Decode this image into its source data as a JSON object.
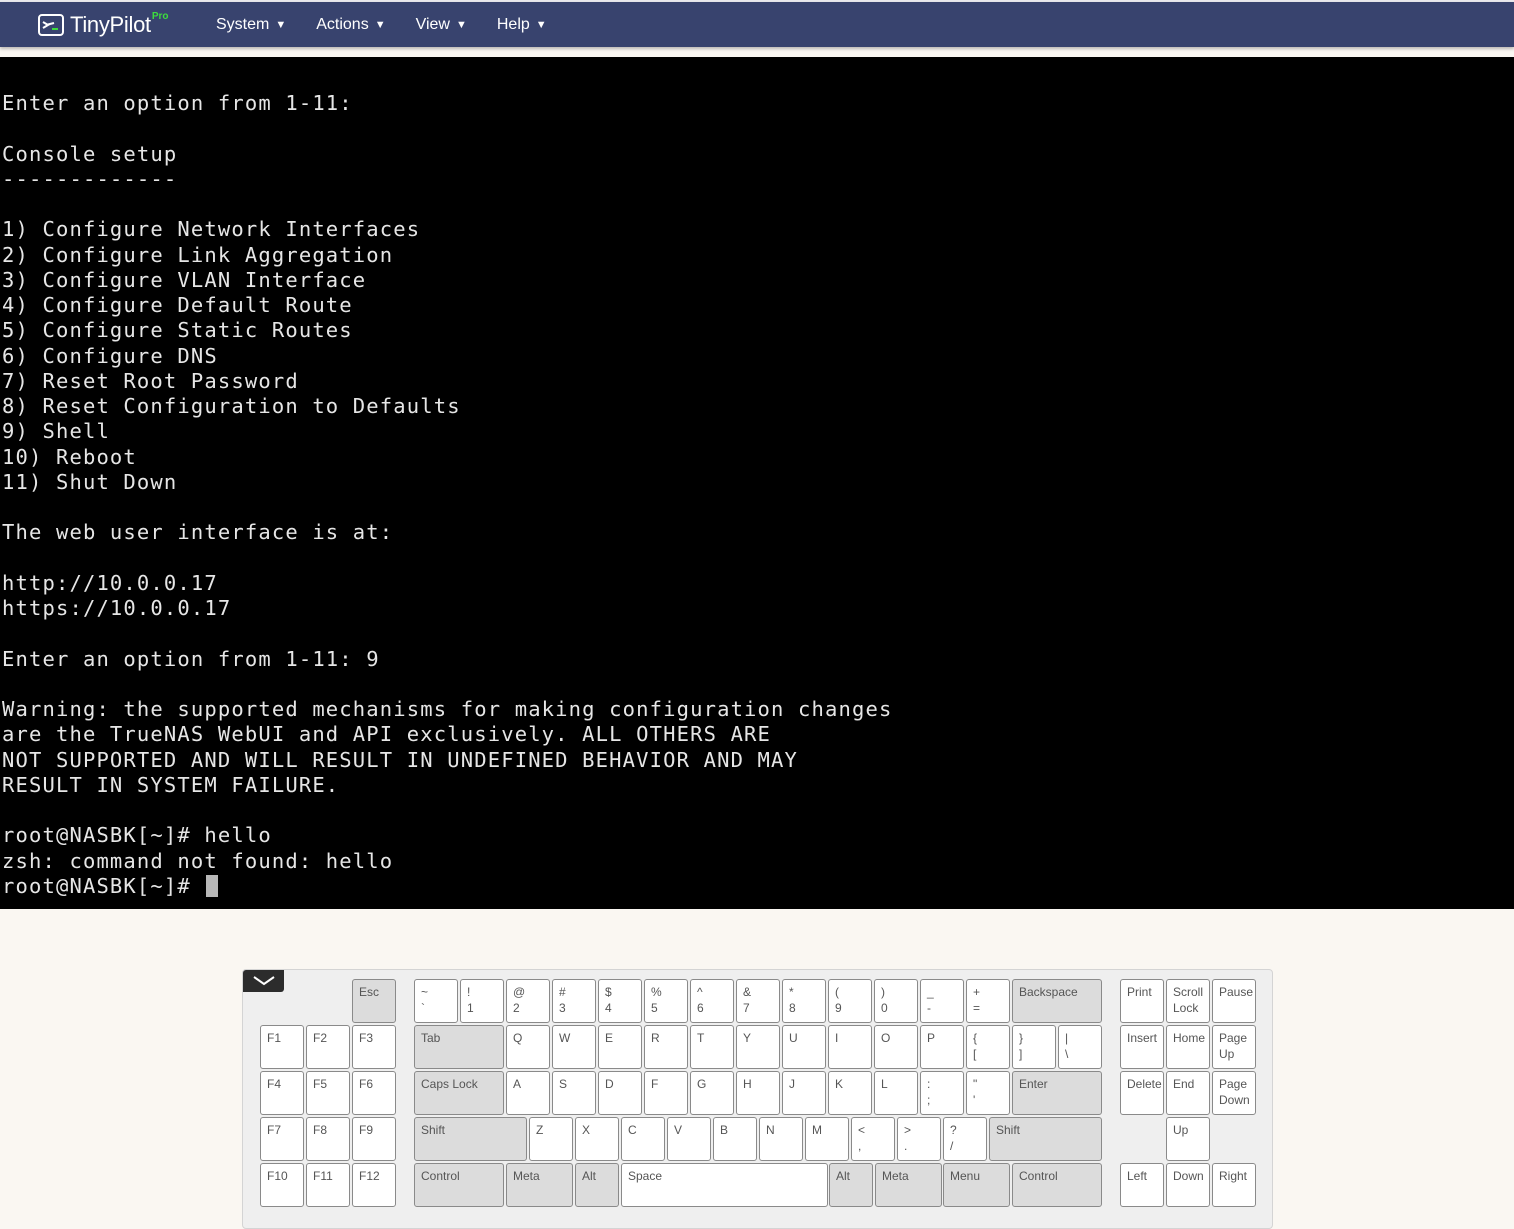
{
  "navbar": {
    "logo_text": "TinyPilot",
    "logo_badge": "Pro",
    "menu": [
      {
        "label": "System",
        "icon": "caret-down-icon"
      },
      {
        "label": "Actions",
        "icon": "caret-down-icon"
      },
      {
        "label": "View",
        "icon": "caret-down-icon"
      },
      {
        "label": "Help",
        "icon": "caret-down-icon"
      }
    ]
  },
  "terminal": {
    "lines": [
      "Enter an option from 1-11:",
      "",
      "Console setup",
      "-------------",
      "",
      "1) Configure Network Interfaces",
      "2) Configure Link Aggregation",
      "3) Configure VLAN Interface",
      "4) Configure Default Route",
      "5) Configure Static Routes",
      "6) Configure DNS",
      "7) Reset Root Password",
      "8) Reset Configuration to Defaults",
      "9) Shell",
      "10) Reboot",
      "11) Shut Down",
      "",
      "The web user interface is at:",
      "",
      "http://10.0.0.17",
      "https://10.0.0.17",
      "",
      "Enter an option from 1-11: 9",
      "",
      "Warning: the supported mechanisms for making configuration changes",
      "are the TrueNAS WebUI and API exclusively. ALL OTHERS ARE",
      "NOT SUPPORTED AND WILL RESULT IN UNDEFINED BEHAVIOR AND MAY",
      "RESULT IN SYSTEM FAILURE.",
      "",
      "root@NASBK[~]# hello",
      "zsh: command not found: hello"
    ],
    "prompt": "root@NASBK[~]# "
  },
  "keyboard": {
    "toggle_icon": "chevron-down-icon",
    "keys": [
      {
        "id": "esc",
        "l1": "Esc",
        "l2": "",
        "mod": true
      },
      {
        "id": "f1",
        "l1": "F1",
        "l2": ""
      },
      {
        "id": "f2",
        "l1": "F2",
        "l2": ""
      },
      {
        "id": "f3",
        "l1": "F3",
        "l2": ""
      },
      {
        "id": "f4",
        "l1": "F4",
        "l2": ""
      },
      {
        "id": "f5",
        "l1": "F5",
        "l2": ""
      },
      {
        "id": "f6",
        "l1": "F6",
        "l2": ""
      },
      {
        "id": "f7",
        "l1": "F7",
        "l2": ""
      },
      {
        "id": "f8",
        "l1": "F8",
        "l2": ""
      },
      {
        "id": "f9",
        "l1": "F9",
        "l2": ""
      },
      {
        "id": "f10",
        "l1": "F10",
        "l2": ""
      },
      {
        "id": "f11",
        "l1": "F11",
        "l2": ""
      },
      {
        "id": "f12",
        "l1": "F12",
        "l2": ""
      },
      {
        "id": "backtick",
        "l1": "~",
        "l2": "`"
      },
      {
        "id": "1",
        "l1": "!",
        "l2": "1"
      },
      {
        "id": "2",
        "l1": "@",
        "l2": "2"
      },
      {
        "id": "3",
        "l1": "#",
        "l2": "3"
      },
      {
        "id": "4",
        "l1": "$",
        "l2": "4"
      },
      {
        "id": "5",
        "l1": "%",
        "l2": "5"
      },
      {
        "id": "6",
        "l1": "^",
        "l2": "6"
      },
      {
        "id": "7",
        "l1": "&",
        "l2": "7"
      },
      {
        "id": "8",
        "l1": "*",
        "l2": "8"
      },
      {
        "id": "9",
        "l1": "(",
        "l2": "9"
      },
      {
        "id": "0",
        "l1": ")",
        "l2": "0"
      },
      {
        "id": "minus",
        "l1": "_",
        "l2": "-"
      },
      {
        "id": "equal",
        "l1": "+",
        "l2": "="
      },
      {
        "id": "backspace",
        "l1": "Backspace",
        "l2": "",
        "mod": true
      },
      {
        "id": "tab",
        "l1": "Tab",
        "l2": "",
        "mod": true
      },
      {
        "id": "q",
        "l1": "Q",
        "l2": ""
      },
      {
        "id": "w",
        "l1": "W",
        "l2": ""
      },
      {
        "id": "e",
        "l1": "E",
        "l2": ""
      },
      {
        "id": "r",
        "l1": "R",
        "l2": ""
      },
      {
        "id": "t",
        "l1": "T",
        "l2": ""
      },
      {
        "id": "y",
        "l1": "Y",
        "l2": ""
      },
      {
        "id": "u",
        "l1": "U",
        "l2": ""
      },
      {
        "id": "i",
        "l1": "I",
        "l2": ""
      },
      {
        "id": "o",
        "l1": "O",
        "l2": ""
      },
      {
        "id": "p",
        "l1": "P",
        "l2": ""
      },
      {
        "id": "lbracket",
        "l1": "{",
        "l2": "["
      },
      {
        "id": "rbracket",
        "l1": "}",
        "l2": "]"
      },
      {
        "id": "backslash",
        "l1": "|",
        "l2": "\\"
      },
      {
        "id": "capslock",
        "l1": "Caps Lock",
        "l2": "",
        "mod": true
      },
      {
        "id": "a",
        "l1": "A",
        "l2": ""
      },
      {
        "id": "s",
        "l1": "S",
        "l2": ""
      },
      {
        "id": "d",
        "l1": "D",
        "l2": ""
      },
      {
        "id": "f",
        "l1": "F",
        "l2": ""
      },
      {
        "id": "g",
        "l1": "G",
        "l2": ""
      },
      {
        "id": "h",
        "l1": "H",
        "l2": ""
      },
      {
        "id": "j",
        "l1": "J",
        "l2": ""
      },
      {
        "id": "k",
        "l1": "K",
        "l2": ""
      },
      {
        "id": "l",
        "l1": "L",
        "l2": ""
      },
      {
        "id": "semicolon",
        "l1": ":",
        "l2": ";"
      },
      {
        "id": "quote",
        "l1": "\"",
        "l2": "'"
      },
      {
        "id": "enter",
        "l1": "Enter",
        "l2": "",
        "mod": true
      },
      {
        "id": "lshift",
        "l1": "Shift",
        "l2": "",
        "mod": true
      },
      {
        "id": "z",
        "l1": "Z",
        "l2": ""
      },
      {
        "id": "x",
        "l1": "X",
        "l2": ""
      },
      {
        "id": "c",
        "l1": "C",
        "l2": ""
      },
      {
        "id": "v",
        "l1": "V",
        "l2": ""
      },
      {
        "id": "b",
        "l1": "B",
        "l2": ""
      },
      {
        "id": "n",
        "l1": "N",
        "l2": ""
      },
      {
        "id": "m",
        "l1": "M",
        "l2": ""
      },
      {
        "id": "comma",
        "l1": "<",
        "l2": ","
      },
      {
        "id": "period",
        "l1": ">",
        "l2": "."
      },
      {
        "id": "slash",
        "l1": "?",
        "l2": "/"
      },
      {
        "id": "rshift",
        "l1": "Shift",
        "l2": "",
        "mod": true
      },
      {
        "id": "lctrl",
        "l1": "Control",
        "l2": "",
        "mod": true
      },
      {
        "id": "lmeta",
        "l1": "Meta",
        "l2": "",
        "mod": true
      },
      {
        "id": "lalt",
        "l1": "Alt",
        "l2": "",
        "mod": true
      },
      {
        "id": "space",
        "l1": "Space",
        "l2": ""
      },
      {
        "id": "ralt",
        "l1": "Alt",
        "l2": "",
        "mod": true
      },
      {
        "id": "rmeta",
        "l1": "Meta",
        "l2": "",
        "mod": true
      },
      {
        "id": "menu",
        "l1": "Menu",
        "l2": "",
        "mod": true
      },
      {
        "id": "rctrl",
        "l1": "Control",
        "l2": "",
        "mod": true
      },
      {
        "id": "print",
        "l1": "Print",
        "l2": ""
      },
      {
        "id": "scrolllock",
        "l1": "Scroll",
        "l2": "Lock"
      },
      {
        "id": "pause",
        "l1": "Pause",
        "l2": ""
      },
      {
        "id": "insert",
        "l1": "Insert",
        "l2": ""
      },
      {
        "id": "home",
        "l1": "Home",
        "l2": ""
      },
      {
        "id": "pageup",
        "l1": "Page",
        "l2": "Up"
      },
      {
        "id": "delete",
        "l1": "Delete",
        "l2": ""
      },
      {
        "id": "end",
        "l1": "End",
        "l2": ""
      },
      {
        "id": "pagedown",
        "l1": "Page",
        "l2": "Down"
      },
      {
        "id": "up",
        "l1": "Up",
        "l2": ""
      },
      {
        "id": "left",
        "l1": "Left",
        "l2": ""
      },
      {
        "id": "down",
        "l1": "Down",
        "l2": ""
      },
      {
        "id": "right",
        "l1": "Right",
        "l2": ""
      }
    ]
  }
}
